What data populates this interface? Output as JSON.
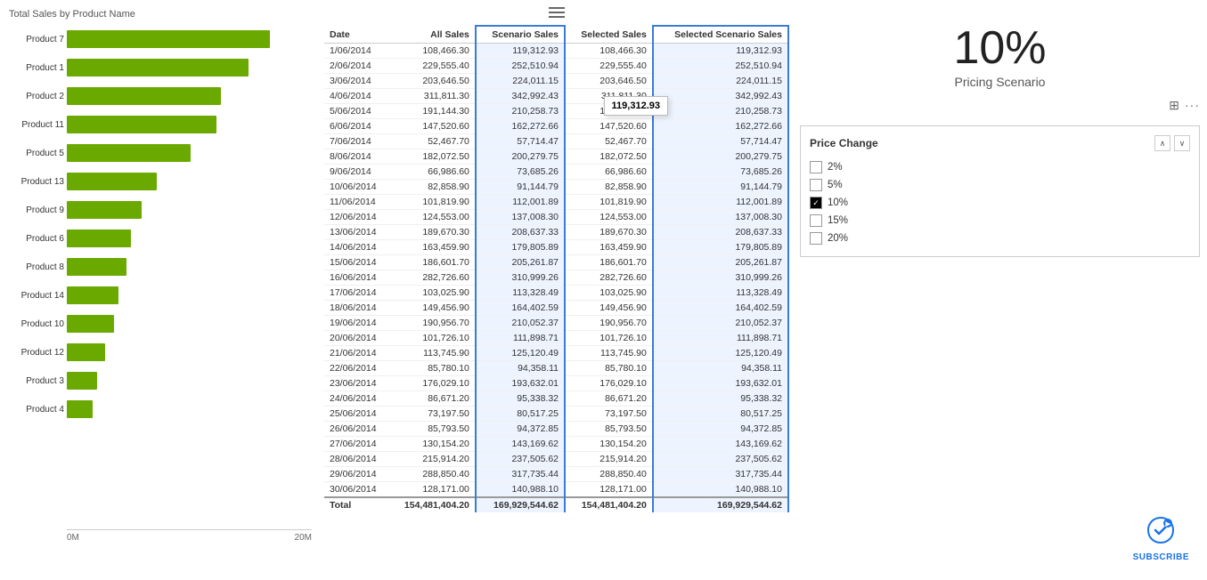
{
  "chart": {
    "title": "Total Sales by Product Name",
    "x_labels": [
      "0M",
      "20M"
    ],
    "bars": [
      {
        "label": "Product 7",
        "width_pct": 95
      },
      {
        "label": "Product 1",
        "width_pct": 85
      },
      {
        "label": "Product 2",
        "width_pct": 72
      },
      {
        "label": "Product 11",
        "width_pct": 70
      },
      {
        "label": "Product 5",
        "width_pct": 58
      },
      {
        "label": "Product 13",
        "width_pct": 42
      },
      {
        "label": "Product 9",
        "width_pct": 35
      },
      {
        "label": "Product 6",
        "width_pct": 30
      },
      {
        "label": "Product 8",
        "width_pct": 28
      },
      {
        "label": "Product 14",
        "width_pct": 24
      },
      {
        "label": "Product 10",
        "width_pct": 22
      },
      {
        "label": "Product 12",
        "width_pct": 18
      },
      {
        "label": "Product 3",
        "width_pct": 14
      },
      {
        "label": "Product 4",
        "width_pct": 12
      }
    ]
  },
  "table": {
    "col_date": "Date",
    "col_all_sales": "All Sales",
    "col_scenario_sales": "Scenario Sales",
    "col_selected_sales": "Selected Sales",
    "col_selected_scenario": "Selected Scenario Sales",
    "rows": [
      {
        "date": "1/06/2014",
        "all_sales": "108,466.30",
        "scenario_sales": "119,312.93",
        "selected_sales": "108,466.30",
        "selected_scenario": "119,312.93"
      },
      {
        "date": "2/06/2014",
        "all_sales": "229,555.40",
        "scenario_sales": "252,510.94",
        "selected_sales": "229,555.40",
        "selected_scenario": "252,510.94"
      },
      {
        "date": "3/06/2014",
        "all_sales": "203,646.50",
        "scenario_sales": "224,011.15",
        "selected_sales": "203,646.50",
        "selected_scenario": "224,011.15"
      },
      {
        "date": "4/06/2014",
        "all_sales": "311,811.30",
        "scenario_sales": "342,992.43",
        "selected_sales": "311,811.30",
        "selected_scenario": "342,992.43"
      },
      {
        "date": "5/06/2014",
        "all_sales": "191,144.30",
        "scenario_sales": "210,258.73",
        "selected_sales": "191,144.30",
        "selected_scenario": "210,258.73"
      },
      {
        "date": "6/06/2014",
        "all_sales": "147,520.60",
        "scenario_sales": "162,272.66",
        "selected_sales": "147,520.60",
        "selected_scenario": "162,272.66"
      },
      {
        "date": "7/06/2014",
        "all_sales": "52,467.70",
        "scenario_sales": "57,714.47",
        "selected_sales": "52,467.70",
        "selected_scenario": "57,714.47"
      },
      {
        "date": "8/06/2014",
        "all_sales": "182,072.50",
        "scenario_sales": "200,279.75",
        "selected_sales": "182,072.50",
        "selected_scenario": "200,279.75"
      },
      {
        "date": "9/06/2014",
        "all_sales": "66,986.60",
        "scenario_sales": "73,685.26",
        "selected_sales": "66,986.60",
        "selected_scenario": "73,685.26"
      },
      {
        "date": "10/06/2014",
        "all_sales": "82,858.90",
        "scenario_sales": "91,144.79",
        "selected_sales": "82,858.90",
        "selected_scenario": "91,144.79"
      },
      {
        "date": "11/06/2014",
        "all_sales": "101,819.90",
        "scenario_sales": "112,001.89",
        "selected_sales": "101,819.90",
        "selected_scenario": "112,001.89"
      },
      {
        "date": "12/06/2014",
        "all_sales": "124,553.00",
        "scenario_sales": "137,008.30",
        "selected_sales": "124,553.00",
        "selected_scenario": "137,008.30"
      },
      {
        "date": "13/06/2014",
        "all_sales": "189,670.30",
        "scenario_sales": "208,637.33",
        "selected_sales": "189,670.30",
        "selected_scenario": "208,637.33"
      },
      {
        "date": "14/06/2014",
        "all_sales": "163,459.90",
        "scenario_sales": "179,805.89",
        "selected_sales": "163,459.90",
        "selected_scenario": "179,805.89"
      },
      {
        "date": "15/06/2014",
        "all_sales": "186,601.70",
        "scenario_sales": "205,261.87",
        "selected_sales": "186,601.70",
        "selected_scenario": "205,261.87"
      },
      {
        "date": "16/06/2014",
        "all_sales": "282,726.60",
        "scenario_sales": "310,999.26",
        "selected_sales": "282,726.60",
        "selected_scenario": "310,999.26"
      },
      {
        "date": "17/06/2014",
        "all_sales": "103,025.90",
        "scenario_sales": "113,328.49",
        "selected_sales": "103,025.90",
        "selected_scenario": "113,328.49"
      },
      {
        "date": "18/06/2014",
        "all_sales": "149,456.90",
        "scenario_sales": "164,402.59",
        "selected_sales": "149,456.90",
        "selected_scenario": "164,402.59"
      },
      {
        "date": "19/06/2014",
        "all_sales": "190,956.70",
        "scenario_sales": "210,052.37",
        "selected_sales": "190,956.70",
        "selected_scenario": "210,052.37"
      },
      {
        "date": "20/06/2014",
        "all_sales": "101,726.10",
        "scenario_sales": "111,898.71",
        "selected_sales": "101,726.10",
        "selected_scenario": "111,898.71"
      },
      {
        "date": "21/06/2014",
        "all_sales": "113,745.90",
        "scenario_sales": "125,120.49",
        "selected_sales": "113,745.90",
        "selected_scenario": "125,120.49"
      },
      {
        "date": "22/06/2014",
        "all_sales": "85,780.10",
        "scenario_sales": "94,358.11",
        "selected_sales": "85,780.10",
        "selected_scenario": "94,358.11"
      },
      {
        "date": "23/06/2014",
        "all_sales": "176,029.10",
        "scenario_sales": "193,632.01",
        "selected_sales": "176,029.10",
        "selected_scenario": "193,632.01"
      },
      {
        "date": "24/06/2014",
        "all_sales": "86,671.20",
        "scenario_sales": "95,338.32",
        "selected_sales": "86,671.20",
        "selected_scenario": "95,338.32"
      },
      {
        "date": "25/06/2014",
        "all_sales": "73,197.50",
        "scenario_sales": "80,517.25",
        "selected_sales": "73,197.50",
        "selected_scenario": "80,517.25"
      },
      {
        "date": "26/06/2014",
        "all_sales": "85,793.50",
        "scenario_sales": "94,372.85",
        "selected_sales": "85,793.50",
        "selected_scenario": "94,372.85"
      },
      {
        "date": "27/06/2014",
        "all_sales": "130,154.20",
        "scenario_sales": "143,169.62",
        "selected_sales": "130,154.20",
        "selected_scenario": "143,169.62"
      },
      {
        "date": "28/06/2014",
        "all_sales": "215,914.20",
        "scenario_sales": "237,505.62",
        "selected_sales": "215,914.20",
        "selected_scenario": "237,505.62"
      },
      {
        "date": "29/06/2014",
        "all_sales": "288,850.40",
        "scenario_sales": "317,735.44",
        "selected_sales": "288,850.40",
        "selected_scenario": "317,735.44"
      },
      {
        "date": "30/06/2014",
        "all_sales": "128,171.00",
        "scenario_sales": "140,988.10",
        "selected_sales": "128,171.00",
        "selected_scenario": "140,988.10"
      }
    ],
    "total": {
      "label": "Total",
      "all_sales": "154,481,404.20",
      "scenario_sales": "169,929,544.62",
      "selected_sales": "154,481,404.20",
      "selected_scenario": "169,929,544.62"
    },
    "tooltip": "119,312.93"
  },
  "kpi": {
    "value": "10%",
    "label": "Pricing Scenario"
  },
  "slicer": {
    "title": "Price Change",
    "items": [
      {
        "label": "2%",
        "checked": false
      },
      {
        "label": "5%",
        "checked": false
      },
      {
        "label": "10%",
        "checked": true
      },
      {
        "label": "15%",
        "checked": false
      },
      {
        "label": "20%",
        "checked": false
      }
    ]
  },
  "subscribe": {
    "text": "SUBSCRIBE"
  },
  "icons": {
    "expand": "⊞",
    "more": "···",
    "up_arrow": "∧",
    "down_arrow": "∨"
  }
}
